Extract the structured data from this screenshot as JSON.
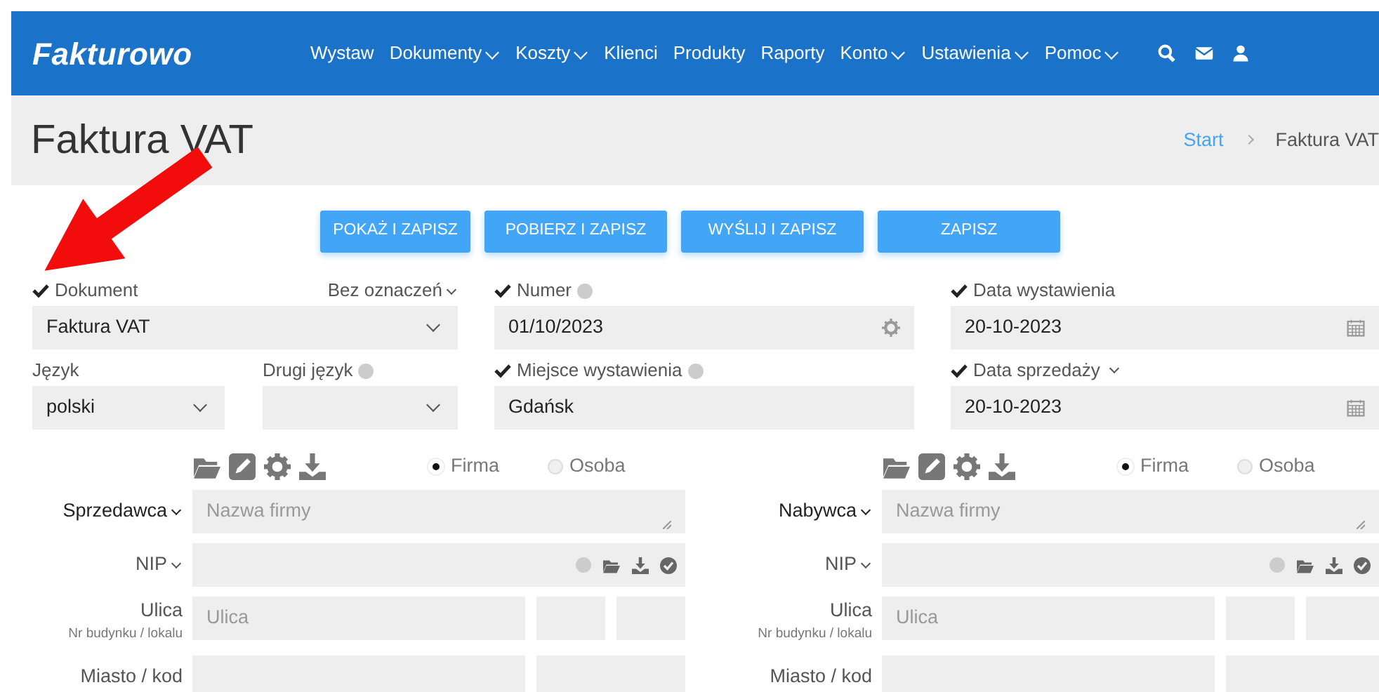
{
  "navbar": {
    "brand": "Fakturowo",
    "items": [
      {
        "label": "Wystaw",
        "dropdown": false
      },
      {
        "label": "Dokumenty",
        "dropdown": true
      },
      {
        "label": "Koszty",
        "dropdown": true
      },
      {
        "label": "Klienci",
        "dropdown": false
      },
      {
        "label": "Produkty",
        "dropdown": false
      },
      {
        "label": "Raporty",
        "dropdown": false
      },
      {
        "label": "Konto",
        "dropdown": true
      },
      {
        "label": "Ustawienia",
        "dropdown": true
      },
      {
        "label": "Pomoc",
        "dropdown": true
      }
    ]
  },
  "page_header": {
    "title": "Faktura VAT",
    "breadcrumb": [
      {
        "label": "Start",
        "link": true
      },
      {
        "label": "Faktura VAT",
        "link": false
      }
    ]
  },
  "actions": [
    "POKAŻ I ZAPISZ",
    "POBIERZ I ZAPISZ",
    "WYŚLIJ I ZAPISZ",
    "ZAPISZ"
  ],
  "document": {
    "label": "Dokument",
    "checked": true,
    "marking": "Bez oznaczeń",
    "value": "Faktura VAT"
  },
  "number": {
    "label": "Numer",
    "checked": true,
    "value": "01/10/2023"
  },
  "issue_date": {
    "label": "Data wystawienia",
    "checked": true,
    "value": "20-10-2023"
  },
  "language": {
    "label": "Język",
    "value": "polski"
  },
  "second_language": {
    "label": "Drugi język"
  },
  "place": {
    "label": "Miejsce wystawienia",
    "checked": true,
    "value": "Gdańsk"
  },
  "sale_date": {
    "label": "Data sprzedaży",
    "checked": true,
    "value": "20-10-2023"
  },
  "parties": [
    {
      "role": "Sprzedawca",
      "entity_options": [
        {
          "label": "Firma",
          "selected": true
        },
        {
          "label": "Osoba",
          "selected": false
        }
      ],
      "name_placeholder": "Nazwa firmy",
      "nip_label": "NIP",
      "street_label": "Ulica",
      "street_sublabel": "Nr budynku / lokalu",
      "street_placeholder": "Ulica",
      "city_label": "Miasto / kod"
    },
    {
      "role": "Nabywca",
      "entity_options": [
        {
          "label": "Firma",
          "selected": true
        },
        {
          "label": "Osoba",
          "selected": false
        }
      ],
      "name_placeholder": "Nazwa firmy",
      "nip_label": "NIP",
      "street_label": "Ulica",
      "street_sublabel": "Nr budynku / lokalu",
      "street_placeholder": "Ulica",
      "city_label": "Miasto / kod"
    }
  ]
}
